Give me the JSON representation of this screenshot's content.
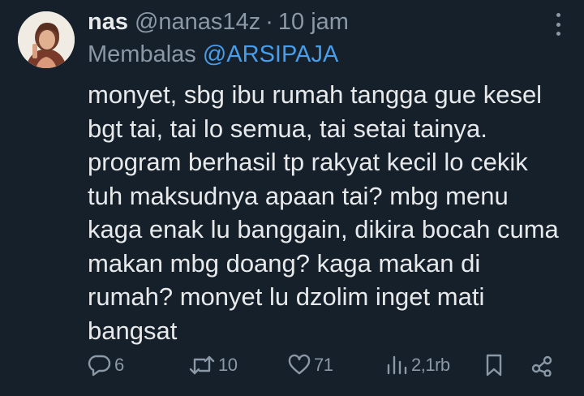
{
  "tweet": {
    "display_name": "nas",
    "handle": "@nanas14z",
    "separator": "·",
    "time": "10 jam",
    "reply_prefix": "Membalas",
    "reply_to": "@ARSIPAJA",
    "text_lines": [
      "monyet, sbg ibu rumah tangga gue kesel",
      "bgt tai, tai lo semua, tai setai tainya.",
      "program berhasil tp rakyat kecil lo cekik",
      "tuh maksudnya apaan tai? mbg menu",
      "kaga enak lu banggain, dikira bocah cuma",
      "makan mbg doang? kaga makan di",
      "rumah? monyet lu dzolim inget mati",
      "bangsat"
    ]
  },
  "actions": {
    "replies": "6",
    "reposts": "10",
    "likes": "71",
    "views": "2,1rb"
  },
  "colors": {
    "background": "#15202b",
    "primary_text": "#e7e9ea",
    "secondary_text": "#8b98a5",
    "mention": "#4a9de8"
  },
  "icons": [
    "reply-icon",
    "repost-icon",
    "like-icon",
    "views-icon",
    "bookmark-icon",
    "share-icon",
    "more-icon"
  ]
}
